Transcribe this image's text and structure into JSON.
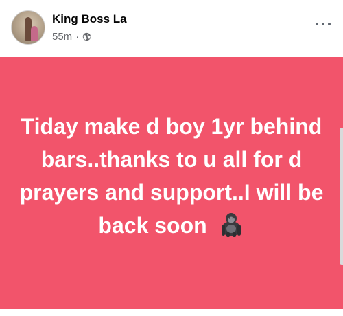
{
  "post": {
    "author": "King Boss La",
    "time": "55m",
    "separator": "·",
    "privacy_icon": "globe-icon",
    "more_icon": "more-options-icon",
    "background_color": "#f2546b",
    "text_color": "#ffffff",
    "text": "Tiday make d boy 1yr behind bars..thanks to u all for d prayers and support..I will be back soon",
    "emoji": "gorilla-emoji"
  }
}
